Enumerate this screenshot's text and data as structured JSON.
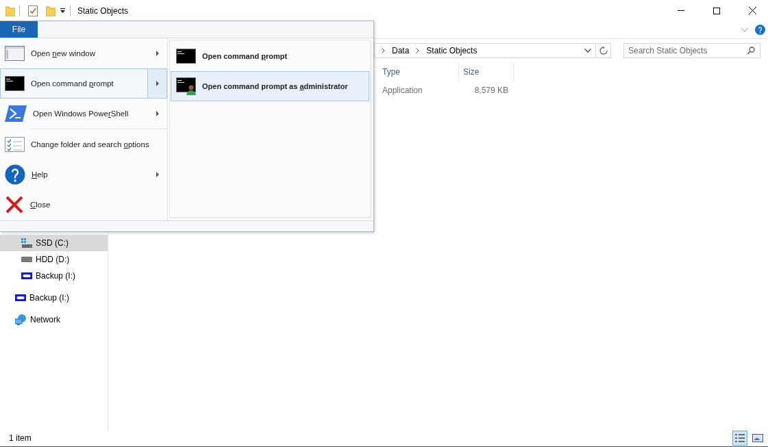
{
  "window": {
    "title": "Static Objects"
  },
  "file_tab": {
    "label": "File",
    "selected": true
  },
  "file_menu": {
    "items": [
      {
        "kind": "window",
        "label": {
          "pre": "Open ",
          "key": "n",
          "post": "ew window"
        },
        "submenu": true,
        "selected": false,
        "separator_after": false
      },
      {
        "kind": "cmd",
        "label": {
          "pre": "Open command ",
          "key": "p",
          "post": "rompt"
        },
        "submenu": true,
        "selected": true,
        "separator_after": false
      },
      {
        "kind": "powershell",
        "label": {
          "pre": "Open Windows Powe",
          "key": "r",
          "post": "Shell"
        },
        "submenu": true,
        "selected": false,
        "separator_after": true
      },
      {
        "kind": "options",
        "label": {
          "pre": "Change folder and search ",
          "key": "o",
          "post": "ptions"
        },
        "submenu": false,
        "selected": false,
        "separator_after": false
      },
      {
        "kind": "help",
        "label": {
          "key": "H",
          "post": "elp"
        },
        "submenu": true,
        "selected": false,
        "separator_after": false
      },
      {
        "kind": "close",
        "label": {
          "key": "C",
          "post": "lose"
        },
        "submenu": false,
        "selected": false,
        "separator_after": false
      }
    ],
    "submenu": [
      {
        "kind": "cmd",
        "label": {
          "pre": "Open command ",
          "key": "p",
          "post": "rompt"
        },
        "selected": false
      },
      {
        "kind": "cmd-admin",
        "label": {
          "pre": "Open command prompt as ",
          "key": "a",
          "post": "dministrator"
        },
        "selected": true
      }
    ]
  },
  "address_bar": {
    "crumbs": [
      "Data",
      "Static Objects"
    ]
  },
  "search": {
    "placeholder": "Search Static Objects"
  },
  "columns": [
    "Type",
    "Size"
  ],
  "rows": [
    {
      "type": "Application",
      "size": "8,579 KB"
    }
  ],
  "nav": {
    "drives": [
      {
        "kind": "ssd",
        "label": "SSD (C:)",
        "selected": true
      },
      {
        "kind": "hdd",
        "label": "HDD (D:)",
        "selected": false
      },
      {
        "kind": "wd",
        "label": "Backup (I:)",
        "selected": false
      }
    ],
    "items": [
      {
        "kind": "wd",
        "label": "Backup (I:)",
        "selected": false
      },
      {
        "kind": "network",
        "label": "Network",
        "selected": false
      }
    ]
  },
  "status_bar": {
    "text": "1 item",
    "views": [
      {
        "kind": "details",
        "selected": true
      },
      {
        "kind": "tiles",
        "selected": false
      }
    ]
  }
}
